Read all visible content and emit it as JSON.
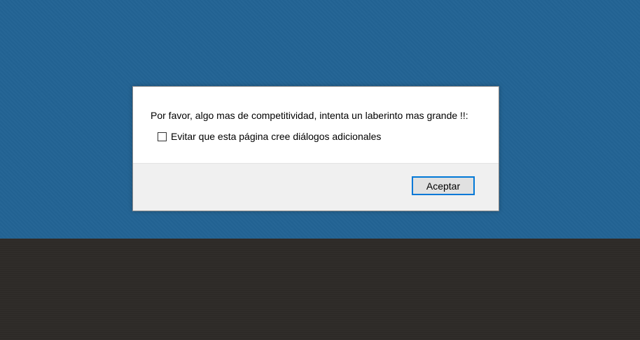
{
  "colors": {
    "top_background": "#236494",
    "bottom_background": "#2e2b28",
    "dialog_body": "#ffffff",
    "dialog_footer": "#f0f0f0",
    "button_border_focus": "#0078d7"
  },
  "dialog": {
    "message": "Por favor, algo mas de competitividad, intenta un laberinto mas grande !!:",
    "checkbox": {
      "label": "Evitar que esta página cree diálogos adicionales",
      "checked": false
    },
    "ok_button_label": "Aceptar"
  }
}
